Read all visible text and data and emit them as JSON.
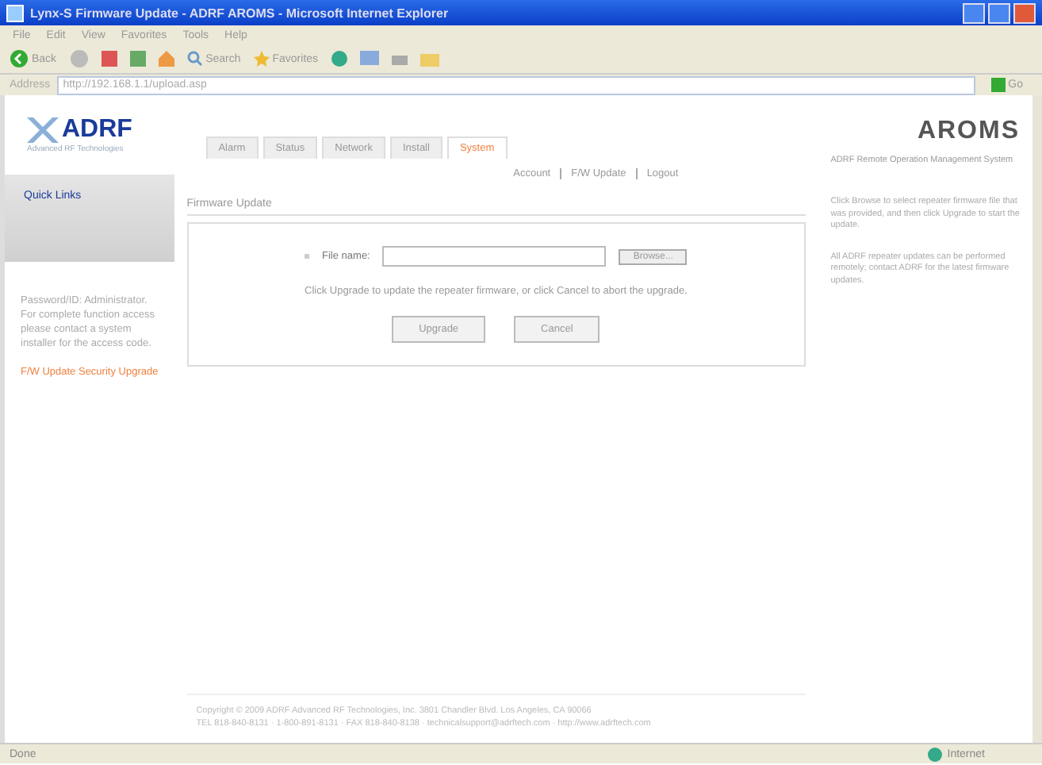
{
  "window": {
    "title": "Lynx-S Firmware Update - ADRF AROMS - Microsoft Internet Explorer"
  },
  "menu": [
    "File",
    "Edit",
    "View",
    "Favorites",
    "Tools",
    "Help"
  ],
  "toolbar": {
    "back": "Back",
    "search": "Search",
    "favorites": "Favorites"
  },
  "address": {
    "label": "Address",
    "url": "http://192.168.1.1/upload.asp",
    "go": "Go"
  },
  "logo": {
    "brand": "ADRF",
    "tagline": "Advanced RF Technologies"
  },
  "product": "AROMS",
  "tabs": [
    {
      "label": "Alarm",
      "selected": false
    },
    {
      "label": "Status",
      "selected": false
    },
    {
      "label": "Network",
      "selected": false
    },
    {
      "label": "Install",
      "selected": false
    },
    {
      "label": "System",
      "selected": true
    }
  ],
  "links": [
    "Account",
    "F/W Update",
    "Logout"
  ],
  "sidebar": {
    "heading": "Quick Links",
    "text": "Password/ID: Administrator. For complete function access please contact a system installer for the access code.",
    "link": "F/W Update Security Upgrade"
  },
  "subtitle": "ADRF Remote Operation Management System",
  "panel": {
    "title": "Firmware Update",
    "file_label": "File name:",
    "browse": "Browse...",
    "message": "Click Upgrade to update the repeater firmware, or click Cancel to abort the upgrade.",
    "buttons": [
      "Upgrade",
      "Cancel"
    ]
  },
  "help": [
    "Click Browse to select repeater firmware file that was provided, and then click Upgrade to start the update.",
    "All ADRF repeater updates can be performed remotely; contact ADRF for the latest firmware updates."
  ],
  "footer": [
    "Copyright © 2009 ADRF Advanced RF Technologies, Inc. 3801 Chandler Blvd. Los Angeles, CA 90066",
    "TEL 818-840-8131 · 1-800-891-8131 · FAX 818-840-8138 · technicalsupport@adrftech.com · http://www.adrftech.com"
  ],
  "status_bar": {
    "text": "Done",
    "zone": "Internet"
  }
}
